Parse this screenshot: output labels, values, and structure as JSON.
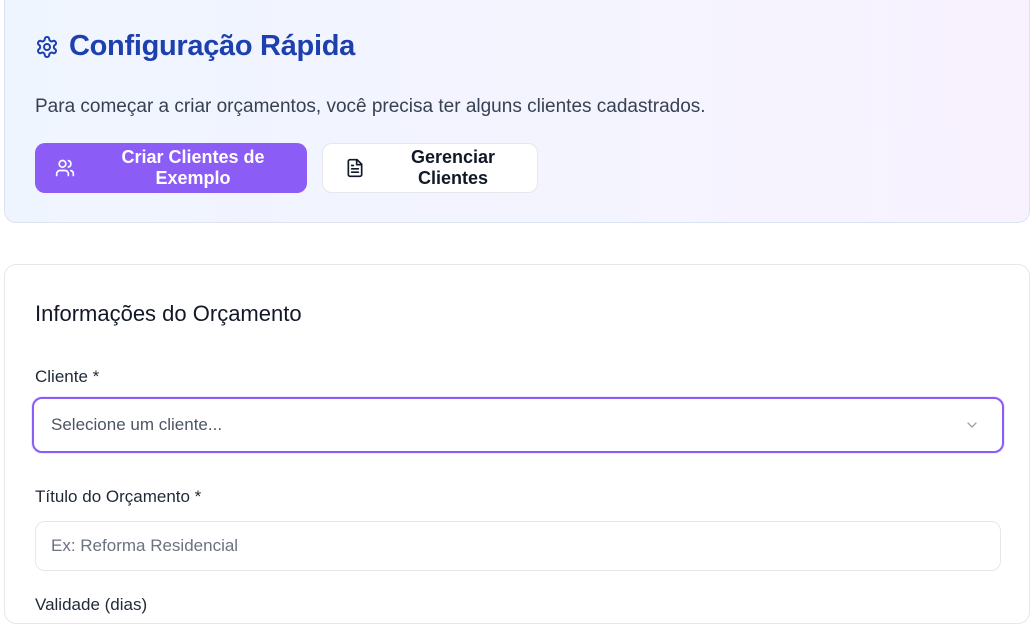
{
  "quick_setup": {
    "title": "Configuração Rápida",
    "description": "Para começar a criar orçamentos, você precisa ter alguns clientes cadastrados.",
    "primary_button_label": "Criar Clientes de Exemplo",
    "secondary_button_label": "Gerenciar Clientes",
    "title_icon": "gear-icon",
    "primary_button_icon": "users-icon",
    "secondary_button_icon": "file-text-icon"
  },
  "budget_info": {
    "title": "Informações do Orçamento",
    "client_label": "Cliente *",
    "client_select_value": "Selecione um cliente...",
    "budget_title_label": "Título do Orçamento *",
    "budget_title_placeholder": "Ex: Reforma Residencial",
    "validity_label": "Validade (dias)"
  },
  "colors": {
    "accent": "#8b5cf6",
    "title_blue": "#1e40af"
  }
}
